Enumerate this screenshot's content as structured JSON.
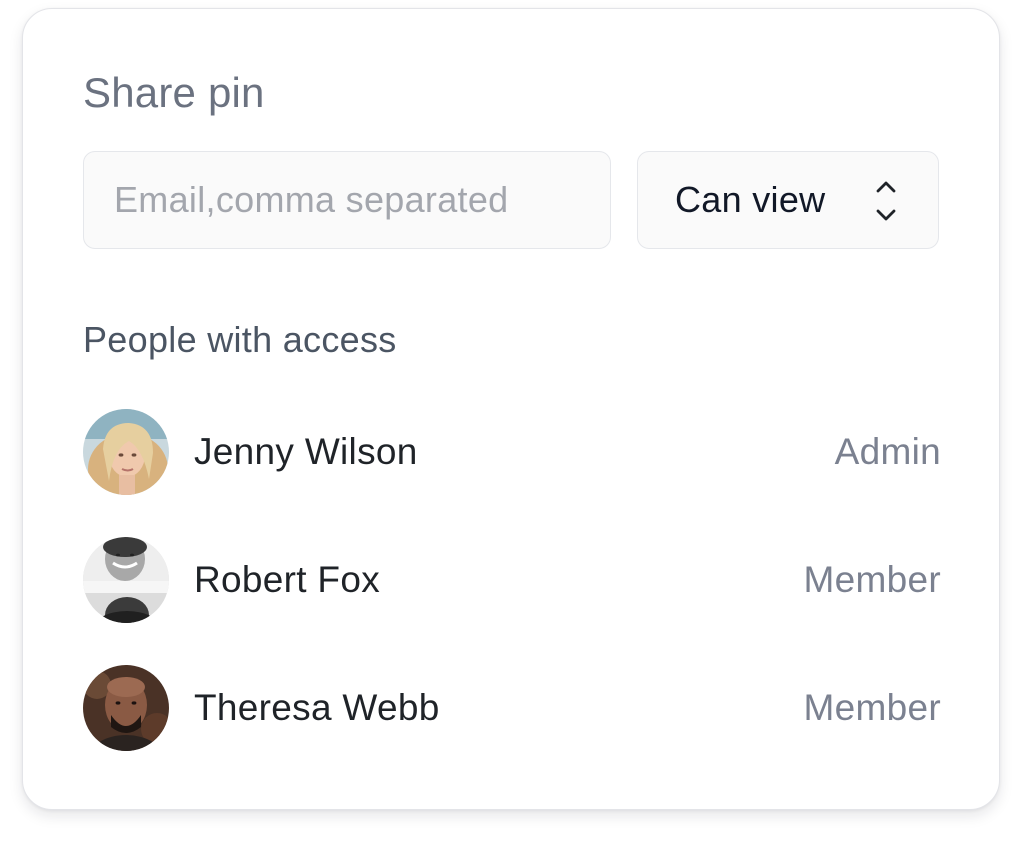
{
  "dialog": {
    "title": "Share pin"
  },
  "invite": {
    "email_placeholder": "Email,comma separated",
    "email_value": "",
    "permission_label": "Can view",
    "permission_icon": "chevron-up-down-icon"
  },
  "access": {
    "heading": "People with access",
    "people": [
      {
        "name": "Jenny Wilson",
        "role": "Admin",
        "avatar": "jenny-wilson-avatar"
      },
      {
        "name": "Robert Fox",
        "role": "Member",
        "avatar": "robert-fox-avatar"
      },
      {
        "name": "Theresa Webb",
        "role": "Member",
        "avatar": "theresa-webb-avatar"
      }
    ]
  }
}
